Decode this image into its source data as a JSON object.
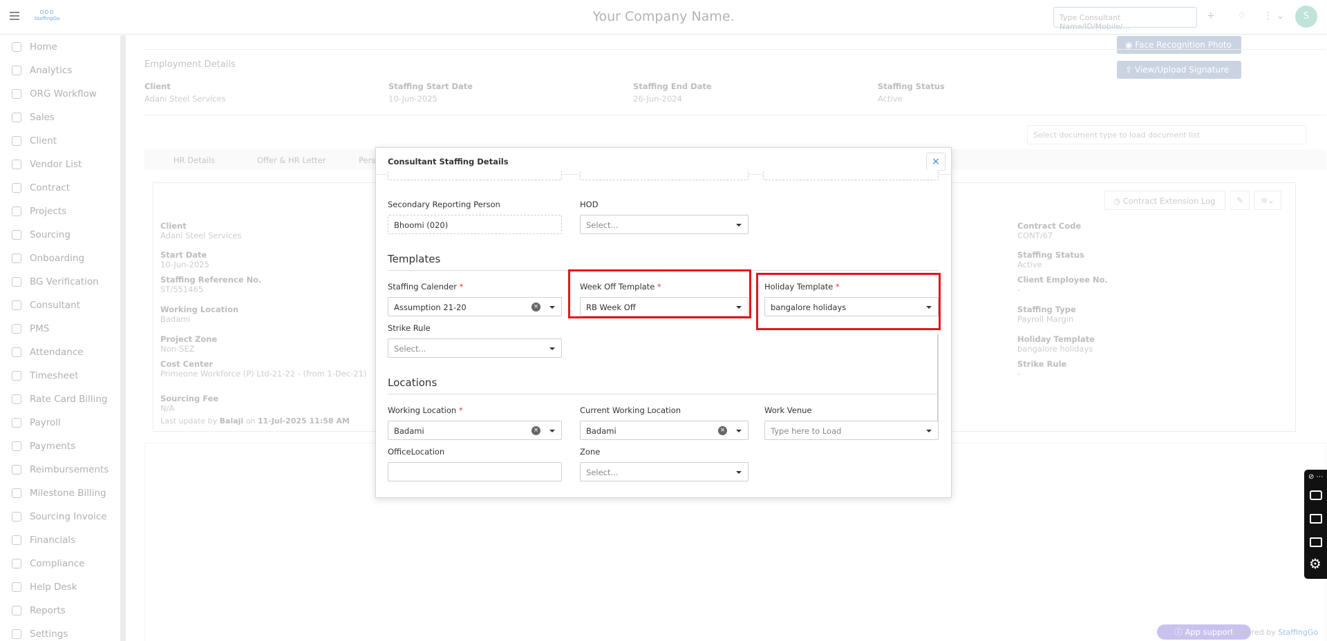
{
  "header": {
    "company": "Your Company Name.",
    "logo_text": "StaffingGo",
    "search_placeholder": "Type Consultant Name/ID/Mobile/...",
    "avatar_initial": "S"
  },
  "sidebar": {
    "items": [
      {
        "label": "Home",
        "icon": "home-icon"
      },
      {
        "label": "Analytics",
        "icon": "analytics-icon"
      },
      {
        "label": "ORG Workflow",
        "icon": "workflow-icon"
      },
      {
        "label": "Sales",
        "icon": "sales-icon"
      },
      {
        "label": "Client",
        "icon": "client-icon"
      },
      {
        "label": "Vendor List",
        "icon": "vendor-icon"
      },
      {
        "label": "Contract",
        "icon": "contract-icon"
      },
      {
        "label": "Projects",
        "icon": "projects-icon"
      },
      {
        "label": "Sourcing",
        "icon": "sourcing-icon"
      },
      {
        "label": "Onboarding",
        "icon": "onboarding-icon"
      },
      {
        "label": "BG Verification",
        "icon": "bg-verification-icon"
      },
      {
        "label": "Consultant",
        "icon": "consultant-icon"
      },
      {
        "label": "PMS",
        "icon": "pms-icon"
      },
      {
        "label": "Attendance",
        "icon": "attendance-icon"
      },
      {
        "label": "Timesheet",
        "icon": "timesheet-icon"
      },
      {
        "label": "Rate Card Billing",
        "icon": "rate-card-icon"
      },
      {
        "label": "Payroll",
        "icon": "payroll-icon"
      },
      {
        "label": "Payments",
        "icon": "payments-icon"
      },
      {
        "label": "Reimbursements",
        "icon": "reimbursements-icon"
      },
      {
        "label": "Milestone Billing",
        "icon": "milestone-icon"
      },
      {
        "label": "Sourcing Invoice",
        "icon": "invoice-icon"
      },
      {
        "label": "Financials",
        "icon": "financials-icon"
      },
      {
        "label": "Compliance",
        "icon": "compliance-icon"
      },
      {
        "label": "Help Desk",
        "icon": "help-icon"
      },
      {
        "label": "Reports",
        "icon": "reports-icon"
      },
      {
        "label": "Settings",
        "icon": "settings-icon"
      }
    ]
  },
  "background": {
    "face_btn": "Face Recognition Photo",
    "signature_btn": "View/Upload Signature",
    "employment_title": "Employment Details",
    "client_label": "Client",
    "client_value": "Adani Steel Services",
    "start_label": "Staffing Start Date",
    "start_value": "10-Jun-2025",
    "end_label": "Staffing End Date",
    "end_value": "26-Jun-2024",
    "status_label": "Staffing Status",
    "status_value": "Active",
    "doc_select_placeholder": "Select document type to load document list",
    "tabs": [
      "HR Details",
      "Offer & HR Letter",
      "Pers"
    ],
    "contract_log_btn": "Contract Extension Log",
    "left_fields": [
      {
        "label": "Client",
        "value": "Adani Steel Services"
      },
      {
        "label": "Start Date",
        "value": "10-Jun-2025"
      },
      {
        "label": "Staffing Reference No.",
        "value": "ST/551465"
      },
      {
        "label": "Working Location",
        "value": "Badami"
      },
      {
        "label": "Project Zone",
        "value": "Non-SEZ"
      },
      {
        "label": "Cost Center",
        "value": "Primeone Workforce (P) Ltd-21-22 - (from 1-Dec-21)"
      },
      {
        "label": "Sourcing Fee",
        "value": "N/A"
      }
    ],
    "right_fields": [
      {
        "label": "Contract Code",
        "value": "CONT/67"
      },
      {
        "label": "Staffing Status",
        "value": "Active"
      },
      {
        "label": "Client Employee No.",
        "value": "-"
      },
      {
        "label": "Staffing Type",
        "value": "Payroll Margin"
      },
      {
        "label": "Holiday Template",
        "value": "bangalore holidays"
      },
      {
        "label": "Strike Rule",
        "value": "-"
      }
    ],
    "last_update_prefix": "Last update by",
    "last_update_user": "Balaji",
    "last_update_on": "on",
    "last_update_time": "11-Jul-2025 11:58 AM"
  },
  "modal": {
    "title": "Consultant Staffing Details",
    "close_glyph": "×",
    "secondary_label": "Secondary Reporting Person",
    "secondary_value": "Bhoomi (020)",
    "hod_label": "HOD",
    "hod_value": "Select...",
    "templates_title": "Templates",
    "calendar_label": "Staffing Calender",
    "calendar_value": "Assumption 21-20",
    "weekoff_label": "Week Off Template",
    "weekoff_value": "RB Week Off",
    "holiday_label": "Holiday Template",
    "holiday_value": "bangalore holidays",
    "strike_label": "Strike Rule",
    "strike_value": "Select...",
    "locations_title": "Locations",
    "working_label": "Working Location",
    "working_value": "Badami",
    "current_label": "Current Working Location",
    "current_value": "Badami",
    "venue_label": "Work Venue",
    "venue_value": "Type here to Load",
    "office_label": "OfficeLocation",
    "office_value": "",
    "zone_label": "Zone",
    "zone_value": "Select...",
    "required_mark": "*"
  },
  "footer": {
    "app_support": "App support",
    "powered_by": "Powered by",
    "brand": "StaffingGo"
  },
  "colors": {
    "highlight": "#e4141c",
    "required": "#e0393e",
    "accent": "#3a8ad6"
  }
}
